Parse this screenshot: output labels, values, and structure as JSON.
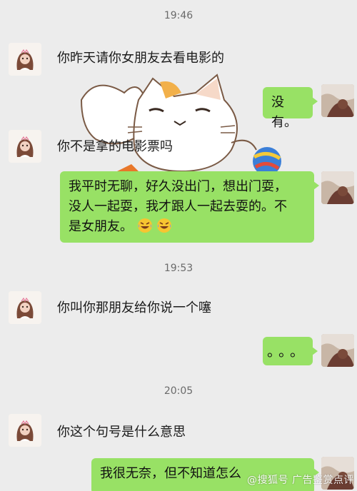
{
  "chat": {
    "messages": [
      {
        "type": "time",
        "text": "19:46"
      },
      {
        "type": "left",
        "text": "你昨天请你女朋友去看电影的"
      },
      {
        "type": "right",
        "text": "没有。"
      },
      {
        "type": "left",
        "text": "你不是拿的电影票吗"
      },
      {
        "type": "right",
        "lines": [
          "我平时无聊，好久没出门，想出门耍，",
          "没人一起耍，我才跟人一起去耍的。不",
          "是女朋友。"
        ]
      },
      {
        "type": "time",
        "text": "19:53"
      },
      {
        "type": "left",
        "text": "你叫你那朋友给你说一个噻"
      },
      {
        "type": "right",
        "text": "。。。"
      },
      {
        "type": "time",
        "text": "20:05"
      },
      {
        "type": "left",
        "text": "你这个句号是什么意思"
      },
      {
        "type": "right",
        "text": "我很无奈，但不知道怎么"
      }
    ]
  },
  "watermark": "@搜狐号 广告鉴赏点评"
}
